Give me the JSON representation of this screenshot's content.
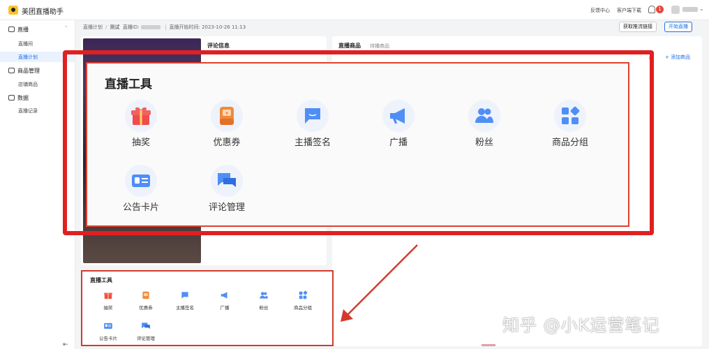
{
  "app": {
    "title": "美团直播助手"
  },
  "topbar": {
    "feedback": "反馈中心",
    "download": "客户端下载",
    "notification_count": "1"
  },
  "sidebar": {
    "groups": [
      {
        "label": "直播",
        "items": [
          "直播间",
          "直播计划"
        ]
      },
      {
        "label": "商品管理",
        "items": [
          "店铺商品"
        ]
      },
      {
        "label": "数据",
        "items": [
          "直播记录"
        ]
      }
    ],
    "active_item": "直播计划"
  },
  "breadcrumb": {
    "parent": "直播计划",
    "current": "测试",
    "live_id_label": "直播ID:",
    "start_time_label": "直播开始时间:",
    "start_time": "2023-10-26 11:13"
  },
  "actions": {
    "get_stream": "获取推流链接",
    "start_live": "开始直播"
  },
  "comments": {
    "title": "评论信息"
  },
  "products": {
    "title": "直播商品",
    "subtitle": "待播商品",
    "add_label": "+ 添加商品",
    "cut_text": "品"
  },
  "tools": {
    "title": "直播工具",
    "items": [
      {
        "label": "抽奖",
        "icon": "gift-icon"
      },
      {
        "label": "优惠券",
        "icon": "coupon-icon"
      },
      {
        "label": "主播签名",
        "icon": "chat-bubble-icon"
      },
      {
        "label": "广播",
        "icon": "megaphone-icon"
      },
      {
        "label": "粉丝",
        "icon": "users-icon"
      },
      {
        "label": "商品分组",
        "icon": "grid-icon"
      },
      {
        "label": "公告卡片",
        "icon": "id-card-icon"
      },
      {
        "label": "评论管理",
        "icon": "comments-icon"
      }
    ]
  },
  "watermark": "知乎 @小K运营笔记",
  "colors": {
    "accent": "#1f6fe0",
    "highlight": "#e02020",
    "gift": "#f04c4c",
    "coupon": "#f08a3c",
    "tool_blue": "#4f8ef7"
  }
}
